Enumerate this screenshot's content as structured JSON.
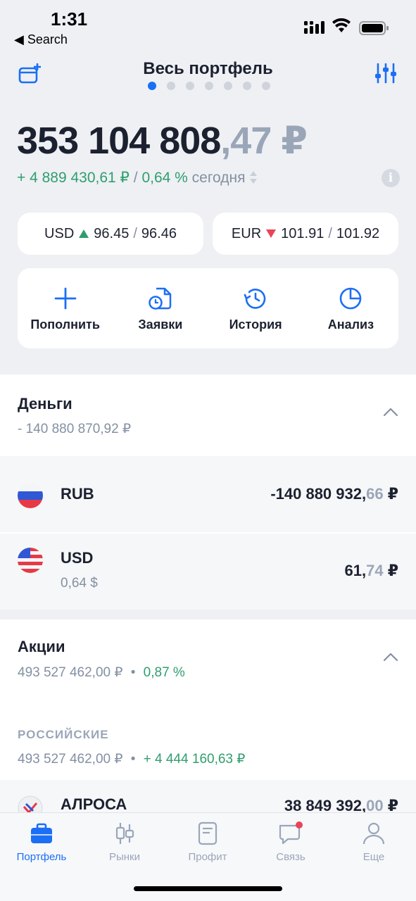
{
  "status": {
    "time": "1:31",
    "back_label": "◀ Search"
  },
  "header": {
    "title": "Весь портфель",
    "page_count": 7,
    "active_page": 1
  },
  "portfolio": {
    "balance_int": "353 104 808",
    "balance_frac": ",47 ₽",
    "change_abs": "+ 4 889 430,61 ₽",
    "change_sep": " / ",
    "change_pct": "0,64 %",
    "period": "сегодня",
    "info_icon": "i"
  },
  "rates": [
    {
      "code": "USD",
      "direction": "up",
      "bid": "96.45",
      "sep": "/",
      "ask": "96.46"
    },
    {
      "code": "EUR",
      "direction": "down",
      "bid": "101.91",
      "sep": "/",
      "ask": "101.92"
    }
  ],
  "actions": [
    {
      "label": "Пополнить",
      "icon": "plus-icon"
    },
    {
      "label": "Заявки",
      "icon": "orders-icon"
    },
    {
      "label": "История",
      "icon": "history-icon"
    },
    {
      "label": "Анализ",
      "icon": "pie-chart-icon"
    }
  ],
  "money": {
    "title": "Деньги",
    "total": "- 140 880 870,92 ₽",
    "items": [
      {
        "name": "RUB",
        "value_int": "-140 880 932,",
        "value_frac": "66",
        "currency": " ₽"
      },
      {
        "name": "USD",
        "sub": "0,64 $",
        "value_int": "61,",
        "value_frac": "74",
        "currency": " ₽"
      }
    ]
  },
  "stocks": {
    "title": "Акции",
    "total": "493 527 462,00 ₽",
    "dot": "•",
    "pct": "0,87 %",
    "group": {
      "title": "РОССИЙСКИЕ",
      "total": "493 527 462,00 ₽",
      "dot": "•",
      "change": "+ 4 444 160,63 ₽"
    },
    "first_item": {
      "name": "АЛРОСА",
      "value_int": "38 849 392,",
      "value_frac": "00",
      "currency": " ₽"
    }
  },
  "tabbar": [
    {
      "label": "Портфель",
      "icon": "briefcase-icon",
      "active": true
    },
    {
      "label": "Рынки",
      "icon": "candles-icon",
      "active": false
    },
    {
      "label": "Профит",
      "icon": "document-icon",
      "active": false
    },
    {
      "label": "Связь",
      "icon": "chat-icon",
      "active": false,
      "badge": true
    },
    {
      "label": "Еще",
      "icon": "person-icon",
      "active": false
    }
  ],
  "colors": {
    "accent": "#1b6ff5",
    "positive": "#2f9e6f",
    "negative": "#e8445a",
    "muted": "#8390a3"
  }
}
